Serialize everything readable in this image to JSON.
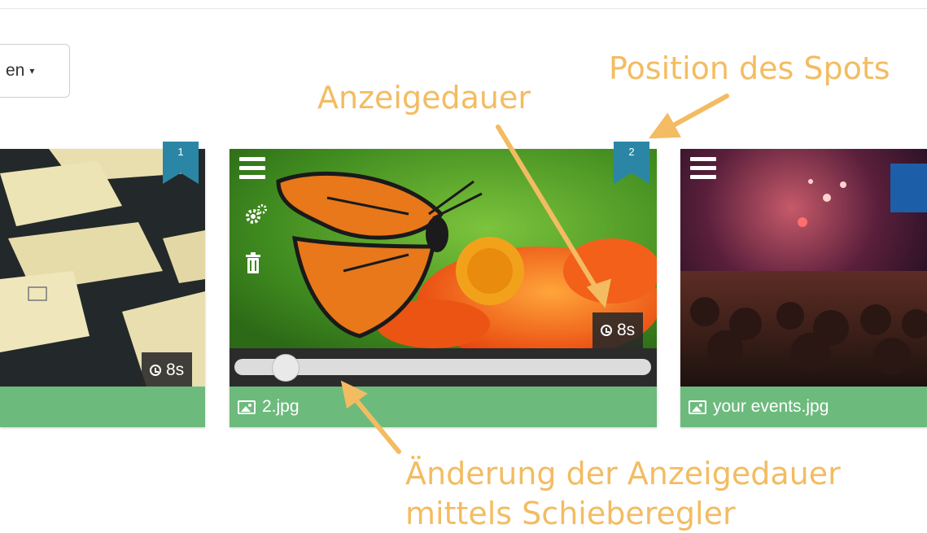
{
  "toolbar": {
    "dropdown_label_partial": "en",
    "dropdown_caret": "▾"
  },
  "cards": [
    {
      "position": "1",
      "duration": "8s",
      "filename": ""
    },
    {
      "position": "2",
      "duration": "8s",
      "filename": "2.jpg",
      "duration_slider": 0.12
    },
    {
      "position": "",
      "duration": "",
      "filename": "your events.jpg"
    }
  ],
  "annotations": {
    "position_label": "Position des Spots",
    "duration_label": "Anzeigedauer",
    "slider_label_line1": "Änderung der Anzeigedauer",
    "slider_label_line2": "mittels Schieberegler"
  },
  "colors": {
    "annotation": "#f3bc62",
    "footer": "#6dba7d",
    "bookmark": "#2b86a5"
  },
  "icons": [
    "menu-icon",
    "gear-icon",
    "trash-icon",
    "clock-icon",
    "image-icon",
    "bookmark-icon",
    "chevron-down-icon"
  ]
}
